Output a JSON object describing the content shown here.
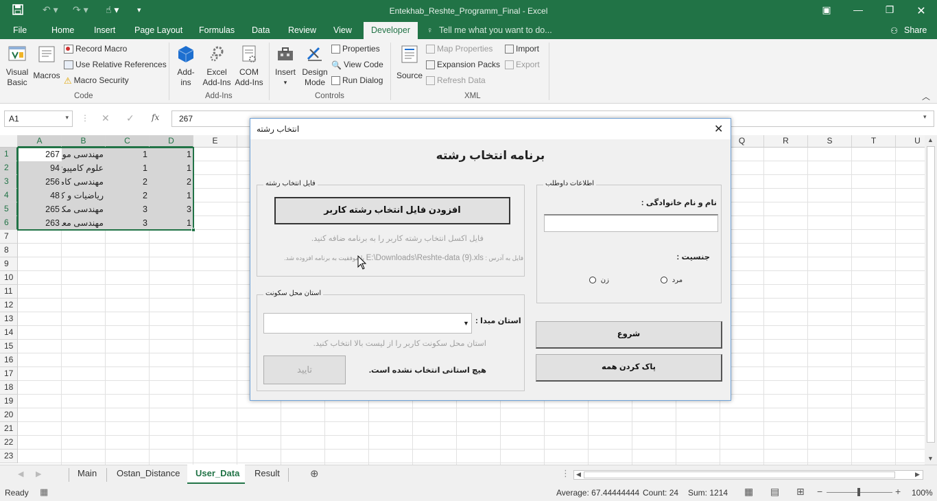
{
  "window": {
    "title": "Entekhab_Reshte_Programm_Final - Excel"
  },
  "tabs": {
    "file": "File",
    "home": "Home",
    "insert": "Insert",
    "page_layout": "Page Layout",
    "formulas": "Formulas",
    "data": "Data",
    "review": "Review",
    "view": "View",
    "developer": "Developer",
    "tell_me": "Tell me what you want to do...",
    "share": "Share"
  },
  "ribbon": {
    "code": {
      "visual_basic_1": "Visual",
      "visual_basic_2": "Basic",
      "macros": "Macros",
      "record_macro": "Record Macro",
      "relative_refs": "Use Relative References",
      "macro_security": "Macro Security",
      "group": "Code"
    },
    "addins": {
      "addins_1": "Add-",
      "addins_2": "ins",
      "excel_addins_1": "Excel",
      "excel_addins_2": "Add-Ins",
      "com_addins_1": "COM",
      "com_addins_2": "Add-Ins",
      "group": "Add-Ins"
    },
    "controls": {
      "insert": "Insert",
      "design_mode_1": "Design",
      "design_mode_2": "Mode",
      "properties": "Properties",
      "view_code": "View Code",
      "run_dialog": "Run Dialog",
      "group": "Controls"
    },
    "xml": {
      "source": "Source",
      "map_properties": "Map Properties",
      "expansion_packs": "Expansion Packs",
      "refresh_data": "Refresh Data",
      "import": "Import",
      "export": "Export",
      "group": "XML"
    }
  },
  "formula_bar": {
    "name_box": "A1",
    "fx": "fx",
    "value": "267"
  },
  "grid": {
    "columns_left": [
      "A",
      "B",
      "C",
      "D",
      "E"
    ],
    "columns_right": [
      "Q",
      "R",
      "S",
      "T",
      "U"
    ],
    "rows": [
      "1",
      "2",
      "3",
      "4",
      "5",
      "6",
      "7",
      "8",
      "9",
      "10",
      "11",
      "12",
      "13",
      "14",
      "15",
      "16",
      "17",
      "18",
      "19",
      "20",
      "21",
      "22",
      "23"
    ],
    "data": [
      {
        "a": "267",
        "b": "مهندسی مواد",
        "c": "1",
        "d": "1"
      },
      {
        "a": "94",
        "b": "علوم کامپیوتر",
        "c": "1",
        "d": "1"
      },
      {
        "a": "256",
        "b": "مهندسی کامپ",
        "c": "2",
        "d": "2"
      },
      {
        "a": "48",
        "b": "ریاضیات و ک",
        "c": "2",
        "d": "1"
      },
      {
        "a": "265",
        "b": "مهندسی مکا",
        "c": "3",
        "d": "3"
      },
      {
        "a": "263",
        "b": "مهندسی معد",
        "c": "3",
        "d": "1"
      }
    ]
  },
  "sheet_tabs": [
    "Main",
    "Ostan_Distance",
    "User_Data",
    "Result"
  ],
  "status_bar": {
    "ready": "Ready",
    "average": "Average: 67.44444444",
    "count": "Count: 24",
    "sum": "Sum: 1214",
    "zoom": "100%"
  },
  "dialog": {
    "title": "انتخاب رشته",
    "heading": "برنامه انتخاب رشته",
    "file_frame": {
      "legend": "فایل انتخاب رشته",
      "add_button": "افزودن فایل انتخاب رشته کاربر",
      "hint": "فایل اکسل انتخاب رشته کاربر را به برنامه ضافه کنید.",
      "success_prefix": "فایل به آدرس :",
      "path": "E:\\Downloads\\Reshte-data (9).xls",
      "success_suffix": "با موفقیت به برنامه افزوده شد."
    },
    "province_frame": {
      "legend": "استان محل سکونت",
      "label": "استان مبدا :",
      "combo_value": "",
      "hint": "استان محل سکونت کاربر را از لیست بالا انتخاب کنید.",
      "confirm_button": "تایید",
      "status": "هیچ استانی انتخاب نشده است."
    },
    "applicant_frame": {
      "legend": "اطلاعات داوطلب",
      "name_label": "نام و نام خانوادگی :",
      "name_value": "",
      "gender_label": "جنسیت :",
      "male": "مرد",
      "female": "زن"
    },
    "start_button": "شروع",
    "clear_button": "پاک کردن همه"
  }
}
